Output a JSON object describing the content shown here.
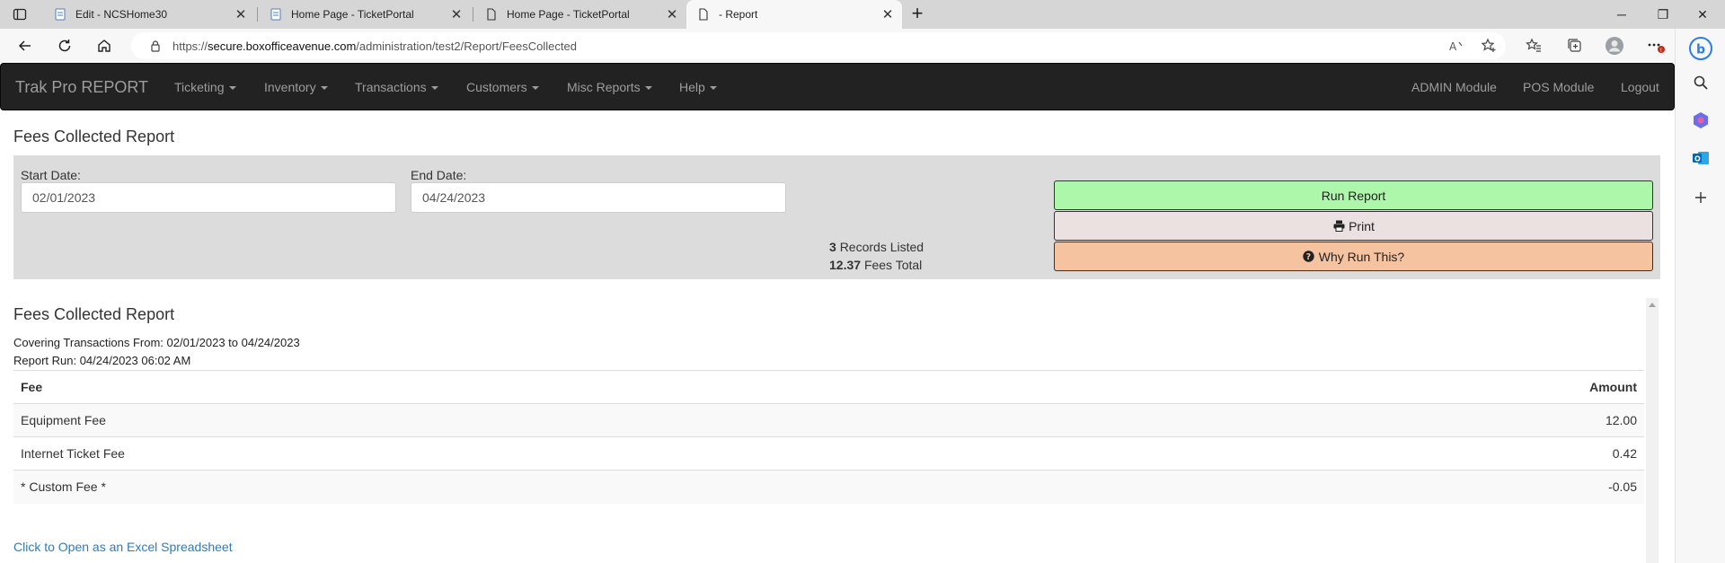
{
  "browser": {
    "tabs": [
      {
        "title": "Edit - NCSHome30",
        "active": false
      },
      {
        "title": "Home Page - TicketPortal",
        "active": false
      },
      {
        "title": "Home Page - TicketPortal",
        "active": false
      },
      {
        "title": "- Report",
        "active": true
      }
    ],
    "url_prefix": "https://",
    "url_host": "secure.boxofficeavenue.com",
    "url_path": "/administration/test2/Report/FeesCollected"
  },
  "nav": {
    "brand": "Trak Pro REPORT",
    "menus": [
      "Ticketing",
      "Inventory",
      "Transactions",
      "Customers",
      "Misc Reports",
      "Help"
    ],
    "right_links": [
      "ADMIN Module",
      "POS Module",
      "Logout"
    ]
  },
  "filters": {
    "heading": "Fees Collected Report",
    "start_label": "Start Date:",
    "start_value": "02/01/2023",
    "end_label": "End Date:",
    "end_value": "04/24/2023",
    "records_count": "3",
    "records_text": "Records Listed",
    "fees_total": "12.37",
    "fees_text": "Fees Total",
    "run_label": "Run Report",
    "print_label": "Print",
    "why_label": "Why Run This?"
  },
  "report": {
    "title": "Fees Collected Report",
    "covering": "Covering Transactions From: 02/01/2023 to 04/24/2023",
    "run_at": "Report Run: 04/24/2023 06:02 AM",
    "columns": {
      "fee": "Fee",
      "amount": "Amount"
    },
    "rows": [
      {
        "fee": "Equipment Fee",
        "amount": "12.00"
      },
      {
        "fee": "Internet Ticket Fee",
        "amount": "0.42"
      },
      {
        "fee": "* Custom Fee *",
        "amount": "-0.05"
      }
    ],
    "excel_link": "Click to Open as an Excel Spreadsheet"
  },
  "colors": {
    "navbar": "#222222",
    "run_button": "#adf7ab",
    "print_button": "#ebe1e1",
    "why_button": "#f6c3a1",
    "link": "#337ab7"
  }
}
